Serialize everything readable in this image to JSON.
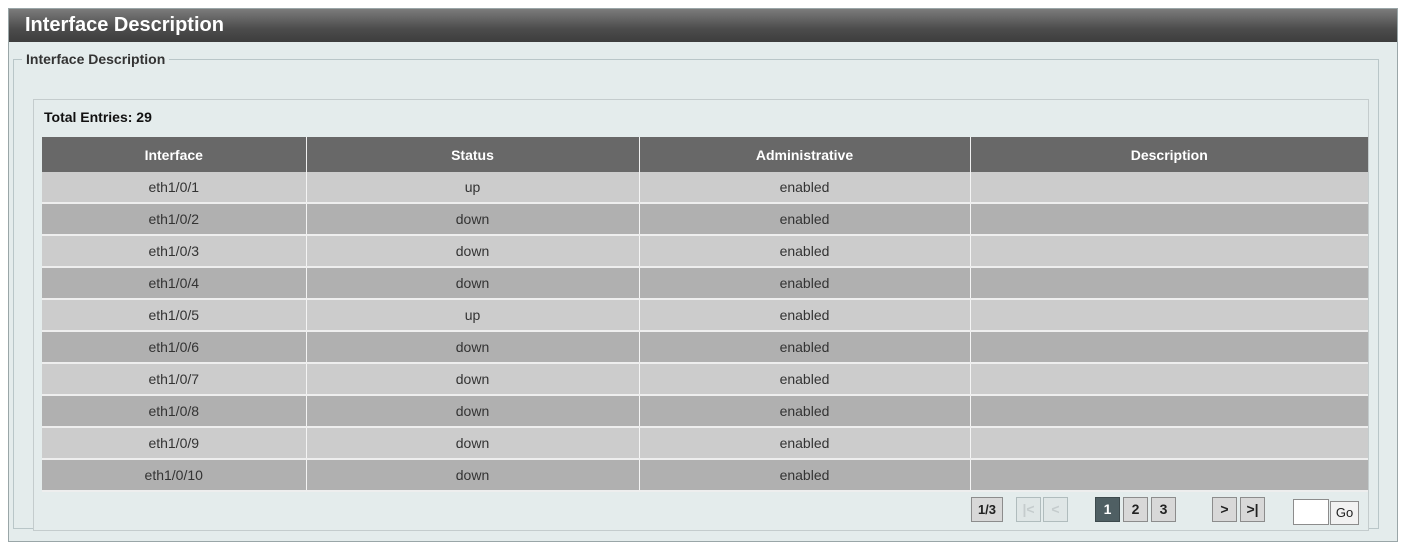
{
  "page": {
    "title": "Interface Description"
  },
  "section": {
    "legend": "Interface Description"
  },
  "table": {
    "total_label": "Total Entries: 29",
    "headers": [
      "Interface",
      "Status",
      "Administrative",
      "Description"
    ],
    "rows": [
      [
        "eth1/0/1",
        "up",
        "enabled",
        ""
      ],
      [
        "eth1/0/2",
        "down",
        "enabled",
        ""
      ],
      [
        "eth1/0/3",
        "down",
        "enabled",
        ""
      ],
      [
        "eth1/0/4",
        "down",
        "enabled",
        ""
      ],
      [
        "eth1/0/5",
        "up",
        "enabled",
        ""
      ],
      [
        "eth1/0/6",
        "down",
        "enabled",
        ""
      ],
      [
        "eth1/0/7",
        "down",
        "enabled",
        ""
      ],
      [
        "eth1/0/8",
        "down",
        "enabled",
        ""
      ],
      [
        "eth1/0/9",
        "down",
        "enabled",
        ""
      ],
      [
        "eth1/0/10",
        "down",
        "enabled",
        ""
      ]
    ]
  },
  "pagination": {
    "page_info": "1/3",
    "first": "|<",
    "prev": "<",
    "pages": [
      "1",
      "2",
      "3"
    ],
    "current_page": "1",
    "next": ">",
    "last": ">|",
    "go_input_value": "",
    "go_label": "Go"
  }
}
